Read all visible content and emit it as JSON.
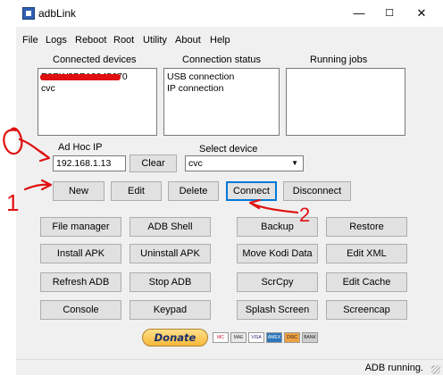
{
  "window": {
    "title": "adbLink",
    "minimize": "—",
    "maximize": "☐",
    "close": "✕"
  },
  "menu": [
    "File",
    "Logs",
    "Reboot",
    "Root",
    "Utility",
    "About",
    "Help"
  ],
  "panels": {
    "connected_label": "Connected devices",
    "status_label": "Connection status",
    "jobs_label": "Running jobs",
    "devices": [
      "E8RW3BP12345670",
      "cvc"
    ],
    "status_lines": [
      "USB connection",
      "IP connection"
    ],
    "jobs": []
  },
  "adhoc": {
    "label": "Ad Hoc IP",
    "value": "192.168.1.13",
    "clear": "Clear"
  },
  "device_select": {
    "label": "Select device",
    "value": "cvc"
  },
  "device_buttons": [
    "New",
    "Edit",
    "Delete",
    "Connect",
    "Disconnect"
  ],
  "function_buttons": [
    [
      "File manager",
      "ADB Shell",
      "Backup",
      "Restore"
    ],
    [
      "Install APK",
      "Uninstall APK",
      "Move Kodi Data",
      "Edit XML"
    ],
    [
      "Refresh ADB",
      "Stop ADB",
      "ScrCpy",
      "Edit Cache"
    ],
    [
      "Console",
      "Keypad",
      "Splash Screen",
      "Screencap"
    ]
  ],
  "donate": {
    "label": "Donate",
    "cards": [
      "MC",
      "MAE",
      "VISA",
      "AMEX",
      "DISC",
      "BANK"
    ]
  },
  "status": "ADB running.",
  "annotations": {
    "num1": "1",
    "num2": "2",
    "color": "#e01010"
  },
  "colors": {
    "window_bg": "#f0f0f0",
    "button_bg": "#e1e1e1",
    "focus_border": "#0078d7",
    "donate_gold": "#f7b83a"
  }
}
